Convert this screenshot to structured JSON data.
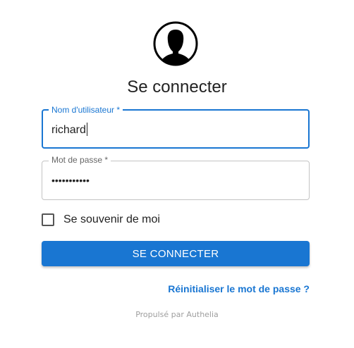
{
  "page": {
    "title": "Se connecter"
  },
  "avatar": {
    "icon": "user-silhouette-icon"
  },
  "form": {
    "username": {
      "label": "Nom d'utilisateur *",
      "value": "richard"
    },
    "password": {
      "label": "Mot de passe *",
      "value": "•••••••••••"
    },
    "remember": {
      "label": "Se souvenir de moi",
      "checked": false
    },
    "submit_label": "SE CONNECTER",
    "reset_link": "Réinitialiser le mot de passe ?"
  },
  "footer": {
    "text": "Propulsé par Authelia"
  },
  "colors": {
    "accent": "#1976d2",
    "muted": "#9e9e9e"
  }
}
